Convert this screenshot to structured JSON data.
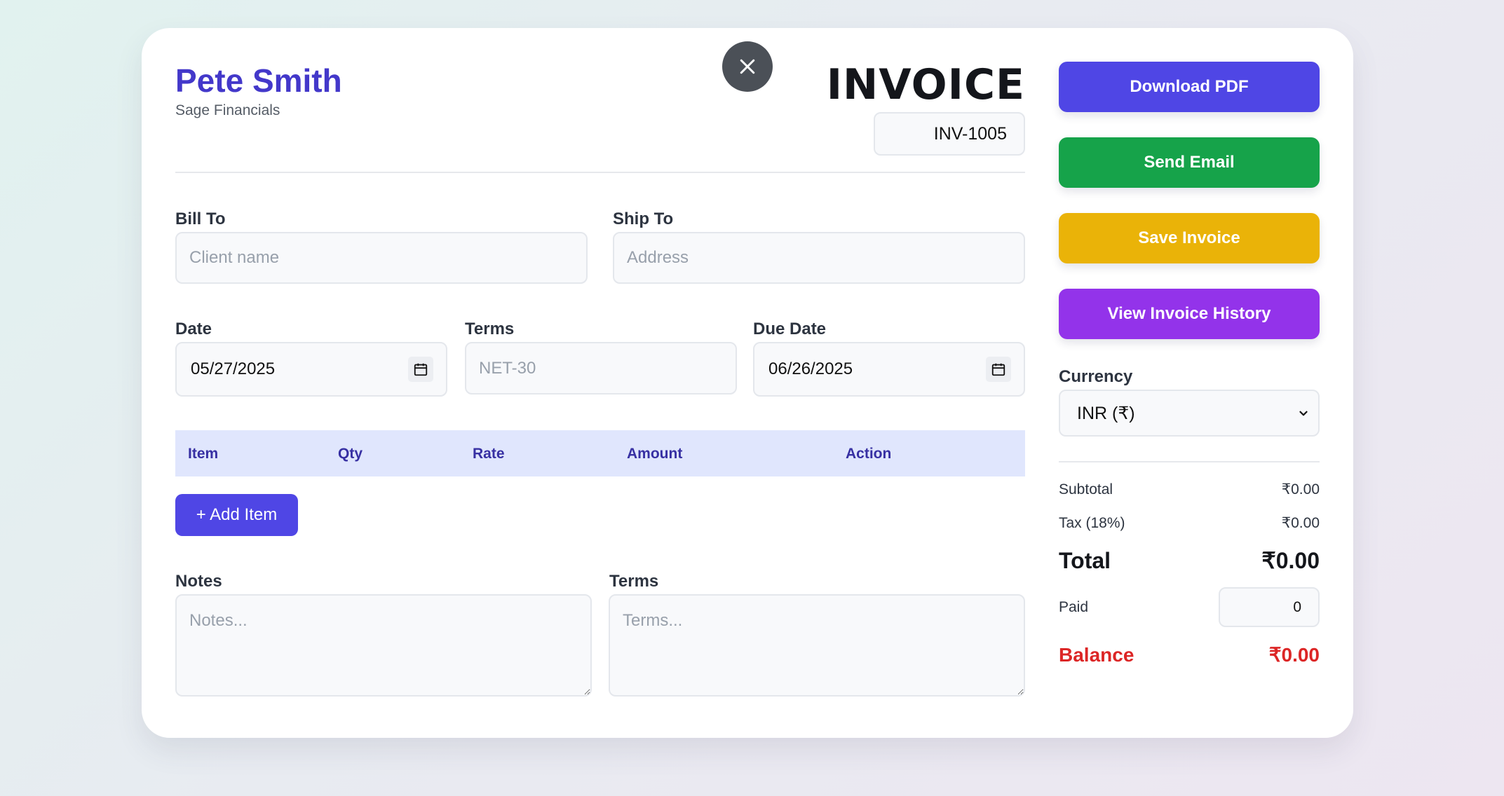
{
  "brand": {
    "name": "Pete Smith",
    "company": "Sage Financials"
  },
  "header": {
    "title": "INVOICE",
    "invoice_number": "INV-1005"
  },
  "billing": {
    "bill_to_label": "Bill To",
    "bill_to_placeholder": "Client name",
    "ship_to_label": "Ship To",
    "ship_to_placeholder": "Address"
  },
  "dates": {
    "date_label": "Date",
    "date_value": "05/27/2025",
    "terms_label": "Terms",
    "terms_placeholder": "NET-30",
    "due_label": "Due Date",
    "due_value": "06/26/2025"
  },
  "table": {
    "columns": [
      "Item",
      "Qty",
      "Rate",
      "Amount",
      "Action"
    ],
    "add_item_label": "+ Add Item"
  },
  "notes": {
    "notes_label": "Notes",
    "notes_placeholder": "Notes...",
    "terms_label": "Terms",
    "terms_placeholder": "Terms..."
  },
  "actions": {
    "download_pdf": "Download PDF",
    "send_email": "Send Email",
    "save_invoice": "Save Invoice",
    "view_history": "View Invoice History"
  },
  "currency": {
    "label": "Currency",
    "selected": "INR (₹)"
  },
  "summary": {
    "subtotal_label": "Subtotal",
    "subtotal_value": "₹0.00",
    "tax_label": "Tax (18%)",
    "tax_value": "₹0.00",
    "total_label": "Total",
    "total_value": "₹0.00",
    "paid_label": "Paid",
    "paid_value": "0",
    "balance_label": "Balance",
    "balance_value": "₹0.00"
  },
  "colors": {
    "accent": "#4f46e5",
    "brand_text": "#4338ca",
    "email": "#16a34a",
    "save": "#eab308",
    "history": "#9333ea",
    "balance": "#dc2626"
  },
  "icons": {
    "close": "close-icon",
    "calendar": "calendar-icon",
    "select": "chevron-down-icon"
  }
}
